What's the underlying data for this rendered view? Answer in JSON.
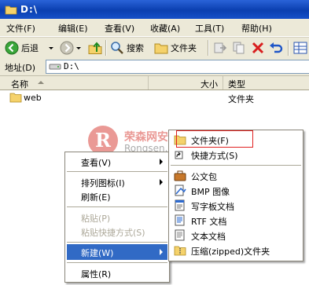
{
  "window": {
    "title": "D:\\"
  },
  "menubar": {
    "items": [
      "文件(F)",
      "编辑(E)",
      "查看(V)",
      "收藏(A)",
      "工具(T)",
      "帮助(H)"
    ]
  },
  "toolbar": {
    "back_label": "后退",
    "search_label": "搜索",
    "folders_label": "文件夹"
  },
  "address": {
    "label": "地址(D)",
    "value": "D:\\"
  },
  "list": {
    "columns": {
      "name": "名称",
      "size": "大小",
      "type": "类型"
    },
    "rows": [
      {
        "name": "web",
        "type": "文件夹"
      }
    ]
  },
  "watermark": {
    "logo": "R",
    "cn": "荣森网安网站维护",
    "en": "Rongsen.Com.Cn"
  },
  "context_menu": {
    "items": [
      {
        "label": "查看(V)",
        "submenu": true,
        "disabled": false
      },
      {
        "label": "排列图标(I)",
        "submenu": true,
        "disabled": false
      },
      {
        "label": "刷新(E)",
        "submenu": false,
        "disabled": false
      },
      {
        "label": "粘贴(P)",
        "submenu": false,
        "disabled": true
      },
      {
        "label": "粘贴快捷方式(S)",
        "submenu": false,
        "disabled": true
      },
      {
        "label": "新建(W)",
        "submenu": true,
        "disabled": false,
        "highlighted": true
      },
      {
        "label": "属性(R)",
        "submenu": false,
        "disabled": false
      }
    ]
  },
  "new_submenu": {
    "items": [
      {
        "label": "文件夹(F)",
        "icon": "folder-icon"
      },
      {
        "label": "快捷方式(S)",
        "icon": "shortcut-icon"
      },
      {
        "label": "公文包",
        "icon": "briefcase-icon"
      },
      {
        "label": "BMP 图像",
        "icon": "bmp-image-icon"
      },
      {
        "label": "写字板文档",
        "icon": "wordpad-icon"
      },
      {
        "label": "RTF 文档",
        "icon": "rtf-document-icon"
      },
      {
        "label": "文本文档",
        "icon": "text-document-icon"
      },
      {
        "label": "压缩(zipped)文件夹",
        "icon": "zip-folder-icon"
      }
    ]
  },
  "colors": {
    "title_bar": "#0a3fb0",
    "chrome": "#ece9d8",
    "highlight": "#316ac5",
    "annotation_box": "#e02020"
  }
}
